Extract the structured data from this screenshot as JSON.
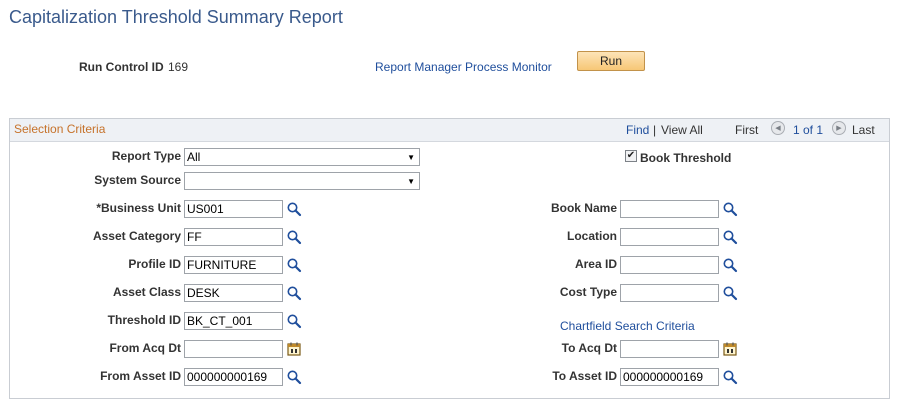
{
  "page": {
    "title": "Capitalization Threshold Summary Report"
  },
  "run_control": {
    "label": "Run Control ID",
    "value": "169",
    "process_monitor_link": "Report Manager Process Monitor",
    "run_button": "Run"
  },
  "section": {
    "title": "Selection Criteria",
    "find": "Find",
    "separator": "|",
    "view_all": "View All",
    "first": "First",
    "pager": "1 of 1",
    "last": "Last"
  },
  "form": {
    "report_type": {
      "label": "Report Type",
      "value": "All"
    },
    "system_source": {
      "label": "System Source",
      "value": ""
    },
    "book_threshold": {
      "label": "Book Threshold",
      "checked": true,
      "check_mark": "✔"
    },
    "business_unit": {
      "label": "*Business Unit",
      "value": "US001"
    },
    "asset_category": {
      "label": "Asset Category",
      "value": "FF"
    },
    "profile_id": {
      "label": "Profile ID",
      "value": "FURNITURE"
    },
    "asset_class": {
      "label": "Asset Class",
      "value": "DESK"
    },
    "threshold_id": {
      "label": "Threshold ID",
      "value": "BK_CT_001"
    },
    "from_acq_dt": {
      "label": "From Acq Dt",
      "value": ""
    },
    "from_asset_id": {
      "label": "From Asset ID",
      "value": "000000000169"
    },
    "book_name": {
      "label": "Book Name",
      "value": ""
    },
    "location": {
      "label": "Location",
      "value": ""
    },
    "area_id": {
      "label": "Area ID",
      "value": ""
    },
    "cost_type": {
      "label": "Cost Type",
      "value": ""
    },
    "chartfield_link": "Chartfield Search Criteria",
    "to_acq_dt": {
      "label": "To Acq Dt",
      "value": ""
    },
    "to_asset_id": {
      "label": "To Asset ID",
      "value": "000000000169"
    }
  },
  "icons": {
    "lookup": "magnifier-icon",
    "calendar": "calendar-icon",
    "prev": "◀",
    "next": "▶",
    "dropdown": "▼"
  },
  "colors": {
    "title": "#3a5a8c",
    "link": "#1f4e9c",
    "section_title": "#c6722a",
    "run_button": "#f7c776"
  }
}
